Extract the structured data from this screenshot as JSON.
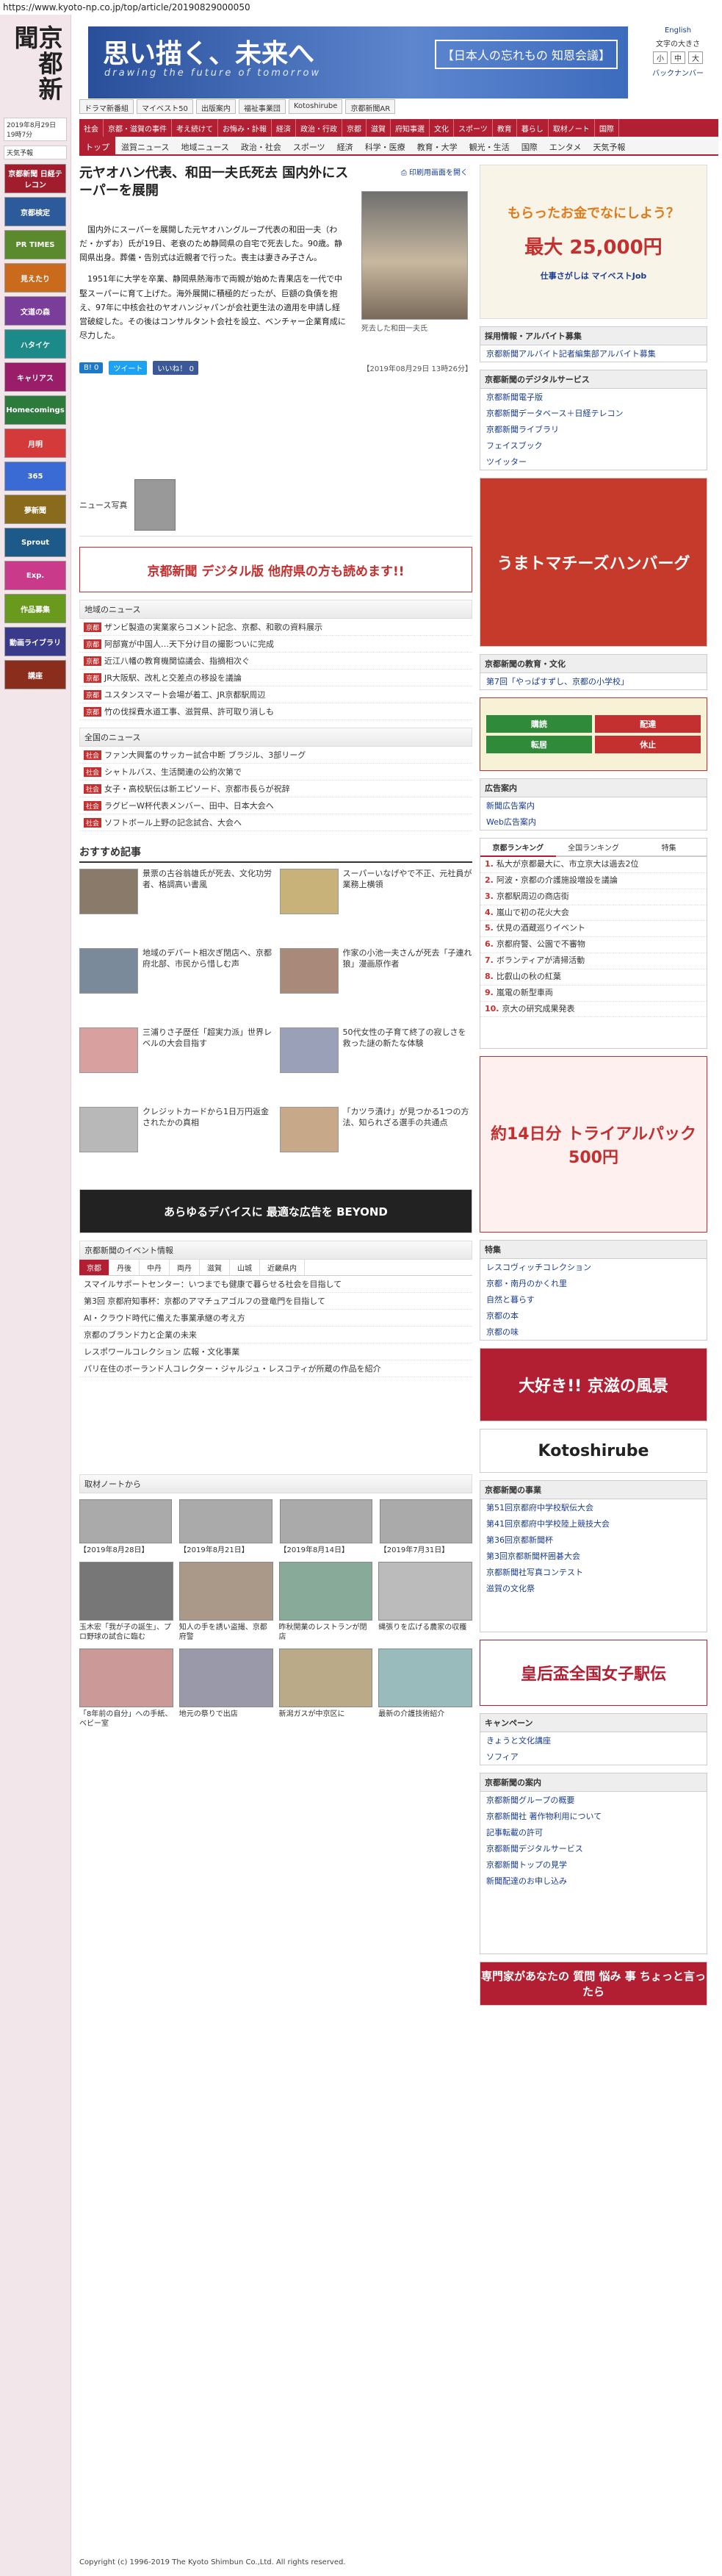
{
  "url": "https://www.kyoto-np.co.jp/top/article/20190829000050",
  "logo": "京都新聞",
  "left": {
    "date": "2019年8月29日 19時7分",
    "weather": "天気予報",
    "banners": [
      "京都新聞 日経テレコン",
      "京都検定",
      "PR TIMES",
      "見えたり",
      "文道の森",
      "ハタイケ",
      "キャリアス",
      "Homecomings",
      "月明",
      "365",
      "夢新聞",
      "Sprout",
      "Exp.",
      "作品募集",
      "動画ライブラリ",
      "講座"
    ]
  },
  "header": {
    "title": "思い描く、未来へ",
    "subtitle": "drawing the future of tomorrow",
    "right_badge": "【日本人の忘れもの 知恩会議】",
    "english": "English",
    "font_size": "文字の大きさ",
    "backnumber": "バックナンバー"
  },
  "nav1": [
    "ドラマ新番組",
    "マイベスト50",
    "出版案内",
    "福祉事業団",
    "Kotoshirube",
    "京都新聞AR"
  ],
  "nav2": [
    "社会",
    "京都・滋賀の事件",
    "考え続けて",
    "お悔み・訃報",
    "経済",
    "政治・行政",
    "京都",
    "滋賀",
    "府知事選",
    "文化",
    "スポーツ",
    "教育",
    "暮らし",
    "取材ノート",
    "国際"
  ],
  "nav3": [
    "トップ",
    "滋賀ニュース",
    "地域ニュース",
    "政治・社会",
    "スポーツ",
    "経済",
    "科学・医療",
    "教育・大学",
    "観光・生活",
    "国際",
    "エンタメ",
    "天気予報"
  ],
  "article": {
    "title": "元ヤオハン代表、和田一夫氏死去 国内外にスーパーを展開",
    "print": "印刷用画面を開く",
    "caption": "死去した和田一夫氏",
    "p1": "国内外にスーパーを展開した元ヤオハングループ代表の和田一夫（わだ・かずお）氏が19日、老衰のため静岡県の自宅で死去した。90歳。静岡県出身。葬儀・告別式は近親者で行った。喪主は妻きみ子さん。",
    "p2": "1951年に大学を卒業、静岡県熱海市で両親が始めた青果店を一代で中堅スーパーに育て上げた。海外展開に積極的だったが、巨額の負債を抱え、97年に中核会社のヤオハンジャパンが会社更生法の適用を申請し経営破綻した。その後はコンサルタント会社を設立、ベンチャー企業育成に尽力した。",
    "date": "【2019年08月29日 13時26分】",
    "news_photo": "ニュース写真",
    "buttons": [
      "B! 0",
      "ツイート",
      "いいね！ 0"
    ]
  },
  "ad_banner": "京都新聞 デジタル版 他府県の方も読めます!!",
  "chiiki": {
    "head": "地域のニュース",
    "items": [
      "ザンビ製造の実業家らコメント記念、京都、和歌の資料展示",
      "阿部寛が中国人…天下分け目の撮影ついに完成",
      "近江八幡の教育機関協議会、指摘相次ぐ",
      "JR大阪駅、改札と交差点の移設を議論",
      "ユスタンスマート会場が着工、JR京都駅周辺",
      "竹の伐採費水道工事、滋賀県、許可取り消しも"
    ]
  },
  "zenkoku": {
    "head": "全国のニュース",
    "items": [
      "ファン大興奮のサッカー試合中断 ブラジル、3部リーグ",
      "シャトルバス、生活関連の公約次第で",
      "女子・高校駅伝は新エピソード、京都市長らが祝辞",
      "ラグビーW杯代表メンバー、田中、日本大会へ",
      "ソフトボール上野の記念試合、大会へ"
    ]
  },
  "recommend": {
    "head": "おすすめ記事",
    "items": [
      "景票の古谷翁雄氏が死去、文化功労者、格調高い書風",
      "スーパーいなげやで不正、元社員が業務上横領",
      "地域のデパート相次ぎ閉店へ、京都府北部、市民から惜しむ声",
      "作家の小池一夫さんが死去「子連れ狼」漫画原作者",
      "三浦りさ子歴任「超実力派」世界レベルの大会目指す",
      "50代女性の子育て終了の寂しさを救った謎の新たな体験",
      "クレジットカードから1日万円返金されたかの真相",
      "「カツラ漬け」が見つかる1つの方法、知られざる選手の共通点"
    ]
  },
  "beyond": "あらゆるデバイスに 最適な広告を BEYOND",
  "events": {
    "head": "京都新聞のイベント情報",
    "tabs": [
      "京都",
      "丹後",
      "中丹",
      "両丹",
      "滋賀",
      "山城",
      "近畿県内"
    ],
    "items": [
      "スマイルサポートセンター：いつまでも健康で暮らせる社会を目指して",
      "第3回 京都府知事杯：京都のアマチュアゴルフの登竜門を目指して",
      "AI・クラウド時代に備えた事業承継の考え方",
      "京都のブランド力と企業の未来",
      "レスポワールコレクション 広報・文化事業",
      "パリ在住のボーランド人コレクター・ジャルジュ・レスコティが所蔵の作品を紹介"
    ]
  },
  "notes": {
    "head": "取材ノートから",
    "items": [
      "【2019年8月28日】",
      "【2019年8月21日】",
      "【2019年8月14日】",
      "【2019年7月31日】"
    ]
  },
  "bottom_cards": [
    "玉木宏「我が子の誕生」、プロ野球の試合に臨む",
    "知人の手を誘い盗撮、京都府警",
    "昨秋開業のレストランが閉店",
    "縄張りを広げる農家の収穫",
    "「8年前の自分」への手紙、ベビー室",
    "地元の祭りで出店",
    "新潟ガスが中京区に",
    "最新の介護技術紹介"
  ],
  "side": {
    "ad1": "もらったお金でなにしよう？",
    "ad1_amount": "最大 25,000円",
    "ad1_note": "仕事さがしは マイベストJob",
    "recruit": {
      "head": "採用情報・アルバイト募集",
      "items": [
        "京都新聞アルバイト記者編集部アルバイト募集"
      ]
    },
    "digital": {
      "head": "京都新聞のデジタルサービス",
      "items": [
        "京都新聞電子版",
        "京都新聞データベース＋日経テレコン",
        "京都新聞ライブラリ",
        "フェイスブック",
        "ツイッター"
      ]
    },
    "ad2": "うまトマチーズハンバーグ",
    "kyoiku": {
      "head": "京都新聞の教育・文化",
      "items": [
        "第7回「やっぱすずし、京都の小学校」"
      ]
    },
    "koukoku": {
      "head": "広告案内",
      "items": [
        "新聞広告案内",
        "Web広告案内"
      ]
    },
    "rank": {
      "tabs": [
        "京都ランキング",
        "全国ランキング",
        "特集"
      ],
      "items": [
        "私大が京都最大に、市立京大は過去2位",
        "阿波・京都の介護施設増設を議論",
        "京都駅周辺の商店街",
        "嵐山で初の花火大会",
        "伏見の酒蔵巡りイベント",
        "京都府警、公園で不審物",
        "ボランティアが清掃活動",
        "比叡山の秋の紅葉",
        "嵐電の新型車両",
        "京大の研究成果発表"
      ]
    },
    "ad3": "約14日分 トライアルパック 500円",
    "tokushu": {
      "head": "特集",
      "items": [
        "レスコヴィッチコレクション",
        "京都・南丹のかくれ里",
        "自然と暮らす",
        "京都の本",
        "京都の味"
      ]
    },
    "photo_contest": "大好き!! 京滋の風景",
    "kotoshirube": "Kotoshirube",
    "events2": {
      "head": "京都新聞の事業",
      "items": [
        "第51回京都府中学校駅伝大会",
        "第41回京都府中学校陸上競技大会",
        "第36回京都新聞杯",
        "第3回京都新聞杯囲碁大会",
        "京都新聞社写真コンテスト",
        "滋賀の文化祭"
      ]
    },
    "ekiden": "皇后盃全国女子駅伝",
    "campaign": {
      "head": "キャンペーン",
      "items": [
        "きょうと文化講座",
        "ソフィア"
      ]
    },
    "guide": {
      "head": "京都新聞の案内",
      "items": [
        "京都新聞グループの概要",
        "京都新聞社 著作物利用について",
        "記事転載の許可",
        "京都新聞デジタルサービス",
        "京都新聞トップの見学",
        "新聞配達のお申し込み"
      ]
    },
    "ad4": "専門家があなたの 質問 悩み 事 ちょっと言ったら"
  },
  "footer": "Copyright (c) 1996-2019 The Kyoto Shimbun Co.,Ltd. All rights reserved."
}
